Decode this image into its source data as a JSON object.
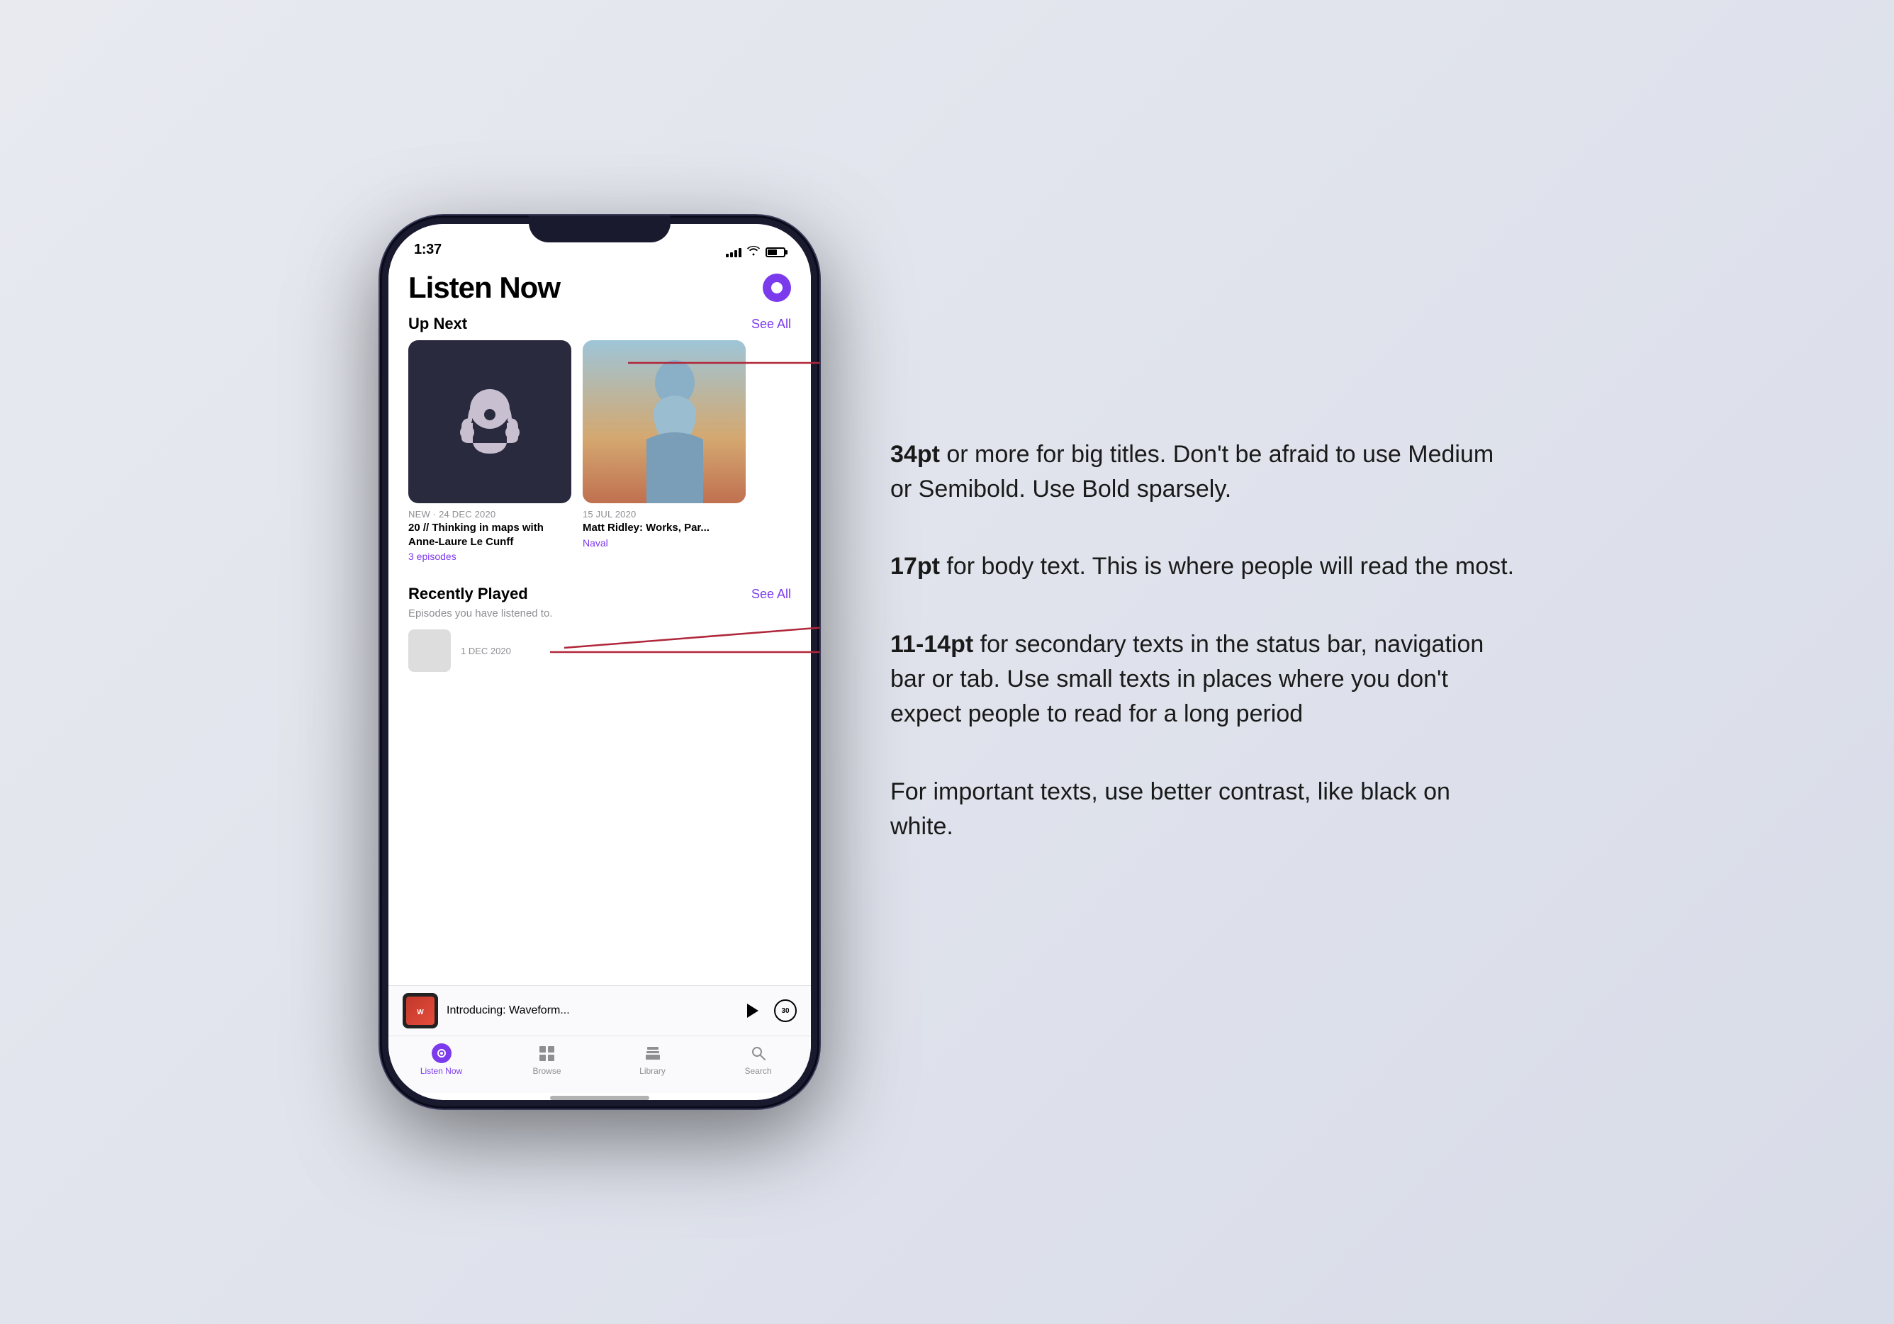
{
  "phone": {
    "status": {
      "time": "1:37",
      "signal_label": "signal-bars",
      "wifi_label": "wifi-icon",
      "battery_label": "battery-icon"
    },
    "header": {
      "title": "Listen Now",
      "avatar_label": "user-avatar"
    },
    "up_next": {
      "section_label": "Up Next",
      "see_all": "See All",
      "cards": [
        {
          "date": "NEW · 24 DEC 2020",
          "title": "20 // Thinking in maps with Anne-Laure Le Cunff",
          "subtitle": "3 episodes",
          "image_type": "headphone"
        },
        {
          "date": "15 JUL 2020",
          "title": "Matt Ridley: Works, Par...",
          "subtitle": "Naval",
          "image_type": "person"
        }
      ]
    },
    "recently_played": {
      "section_label": "Recently Played",
      "see_all": "See All",
      "description": "Episodes you have listened to."
    },
    "mini_player": {
      "title": "Introducing: Waveform...",
      "play_label": "play-button",
      "skip_label": "30-second-skip"
    },
    "tab_bar": {
      "tabs": [
        {
          "label": "Listen Now",
          "active": true,
          "icon": "listen-now-icon"
        },
        {
          "label": "Browse",
          "active": false,
          "icon": "browse-icon"
        },
        {
          "label": "Library",
          "active": false,
          "icon": "library-icon"
        },
        {
          "label": "Search",
          "active": false,
          "icon": "search-icon"
        }
      ]
    }
  },
  "guide": {
    "sections": [
      {
        "bold_part": "34pt",
        "regular_part": " or more for big titles. Don't be afraid to use Medium or Semibold. Use Bold sparsely."
      },
      {
        "bold_part": "17pt",
        "regular_part": " for body text. This is where people will read the most."
      },
      {
        "bold_part": "11-14pt",
        "regular_part": " for secondary texts in the status bar, navigation bar or tab. Use small texts in places where you don't expect people to read for a long period"
      },
      {
        "bold_part": "",
        "regular_part": "For important texts, use better contrast, like black on white."
      }
    ]
  },
  "colors": {
    "purple": "#7c3aed",
    "dark_bg": "#2a2a3e",
    "text_primary": "#000000",
    "text_secondary": "#8e8e93",
    "background": "#e8eaf0"
  }
}
